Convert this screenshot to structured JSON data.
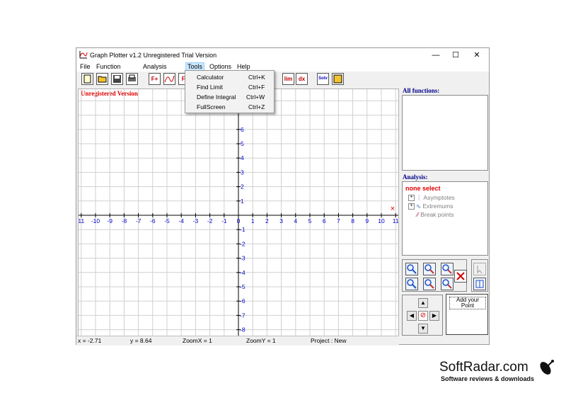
{
  "window": {
    "title": "Graph Plotter v1.2  Unregistered Trial Version",
    "minimize": "—",
    "maximize": "☐",
    "close": "✕"
  },
  "menu": [
    "File",
    "Function",
    "Analysis",
    "Tools",
    "Options",
    "Help"
  ],
  "tools_menu": [
    {
      "label": "Calculator",
      "shortcut": "Ctrl+K"
    },
    {
      "label": "Find Limit",
      "shortcut": "Ctrl+F"
    },
    {
      "label": "Define Integral",
      "shortcut": "Ctrl+W"
    },
    {
      "label": "FullScreen",
      "shortcut": "Ctrl+Z"
    }
  ],
  "toolbar": {
    "f_plus": "F+",
    "f_label": "F-",
    "lim_label": "lim",
    "dx_label": "dx",
    "solve_label": "Solv"
  },
  "graph": {
    "watermark": "Unregistered Version",
    "x_ticks": [
      "11",
      "-10",
      "-9",
      "-8",
      "-7",
      "-6",
      "-5",
      "-4",
      "-3",
      "-2",
      "-1",
      "0",
      "1",
      "2",
      "3",
      "4",
      "5",
      "6",
      "7",
      "8",
      "9",
      "10",
      "11"
    ],
    "y_ticks_pos": [
      "6",
      "5",
      "4",
      "3",
      "2",
      "1"
    ],
    "y_ticks_neg": [
      "-1",
      "-2",
      "-3",
      "-4",
      "-5",
      "-6",
      "-7",
      "-8"
    ],
    "marker": "×",
    "axis_color": "#000000",
    "tick_color": "#0000cc",
    "grid_color": "#d0d0d0"
  },
  "status": {
    "x": "x = -2.71",
    "y": "y = 8.64",
    "zoomx": "ZoomX = 1",
    "zoomy": "ZoomY = 1",
    "project": "Project : New"
  },
  "side": {
    "all_functions": "All functions:",
    "analysis": "Analysis:",
    "none_select": "none select",
    "tree": [
      "Asymptotes",
      "Extremums",
      "Break points"
    ],
    "add_point": "Add your Point"
  },
  "brand": {
    "name": "SoftRadar.com",
    "tagline": "Software reviews & downloads"
  }
}
